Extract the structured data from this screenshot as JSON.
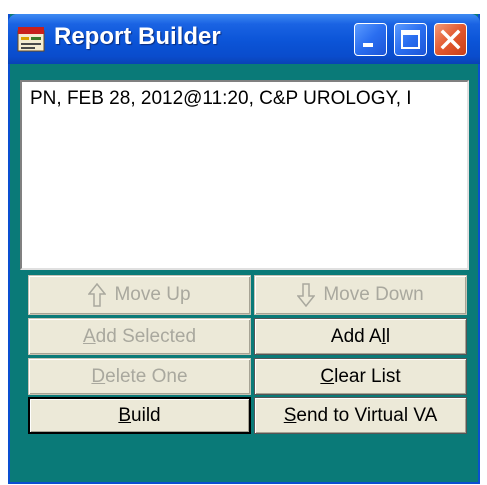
{
  "window": {
    "title": "Report Builder",
    "icon": "report-app-icon",
    "controls": [
      "minimize-icon",
      "maximize-icon",
      "close-icon"
    ]
  },
  "list": {
    "items": [
      "PN, FEB 28, 2012@11:20, C&P UROLOGY, I"
    ]
  },
  "buttons": {
    "move_up": "Move Up",
    "move_down": "Move Down",
    "add_selected": {
      "mnemonic": "A",
      "rest": "dd Selected",
      "enabled": false
    },
    "add_all": {
      "pre": "Add A",
      "mnemonic": "l",
      "rest": "l",
      "enabled": true
    },
    "delete_one": {
      "mnemonic": "D",
      "rest": "elete One",
      "enabled": false
    },
    "clear_list": {
      "mnemonic": "C",
      "rest": "lear List",
      "enabled": true
    },
    "build": {
      "mnemonic": "B",
      "rest": "uild",
      "enabled": true
    },
    "send_to_virtual_va": {
      "mnemonic": "S",
      "rest": "end to Virtual VA",
      "enabled": true
    }
  },
  "colors": {
    "titlebar": "#0b54d7",
    "window_body": "#0a7a78",
    "button_face": "#ece9d8",
    "disabled_text": "#a9a89e"
  }
}
